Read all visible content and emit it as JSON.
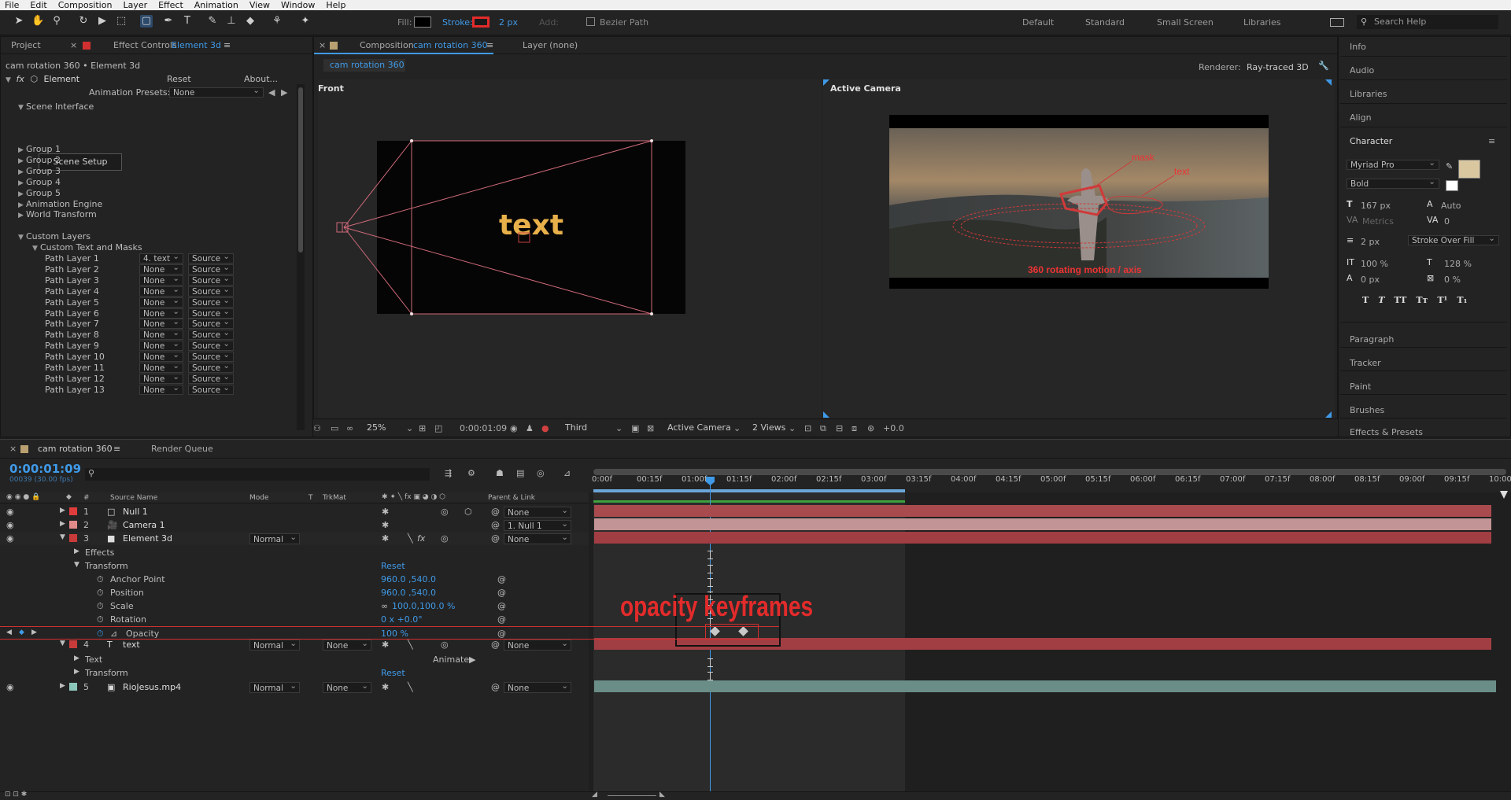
{
  "menu": [
    "File",
    "Edit",
    "Composition",
    "Layer",
    "Effect",
    "Animation",
    "View",
    "Window",
    "Help"
  ],
  "toolbar": {
    "fill_label": "Fill:",
    "stroke_label": "Stroke:",
    "stroke_px": "2 px",
    "add_label": "Add:",
    "bezier_label": "Bezier Path",
    "workspaces": [
      "Default",
      "Standard",
      "Small Screen",
      "Libraries"
    ],
    "search_placeholder": "Search Help",
    "fill_color": "#000000",
    "stroke_color": "#e22b2b"
  },
  "effect_panel": {
    "tab_project": "Project",
    "tab_effect": "Effect Controls",
    "tab_effect_target": "Element 3d",
    "subtitle": "cam rotation 360 • Element 3d",
    "fx_name": "Element",
    "reset": "Reset",
    "about": "About...",
    "presets_label": "Animation Presets:",
    "presets_value": "None",
    "scene_interface": "Scene Interface",
    "scene_setup": "Scene Setup",
    "groups": [
      "Group 1",
      "Group 2",
      "Group 3",
      "Group 4",
      "Group 5",
      "Animation Engine",
      "World Transform"
    ],
    "custom_layers": "Custom Layers",
    "custom_text": "Custom Text and Masks",
    "path_layers": [
      {
        "name": "Path Layer 1",
        "layer": "4. text",
        "src": "Source"
      },
      {
        "name": "Path Layer 2",
        "layer": "None",
        "src": "Source"
      },
      {
        "name": "Path Layer 3",
        "layer": "None",
        "src": "Source"
      },
      {
        "name": "Path Layer 4",
        "layer": "None",
        "src": "Source"
      },
      {
        "name": "Path Layer 5",
        "layer": "None",
        "src": "Source"
      },
      {
        "name": "Path Layer 6",
        "layer": "None",
        "src": "Source"
      },
      {
        "name": "Path Layer 7",
        "layer": "None",
        "src": "Source"
      },
      {
        "name": "Path Layer 8",
        "layer": "None",
        "src": "Source"
      },
      {
        "name": "Path Layer 9",
        "layer": "None",
        "src": "Source"
      },
      {
        "name": "Path Layer 10",
        "layer": "None",
        "src": "Source"
      },
      {
        "name": "Path Layer 11",
        "layer": "None",
        "src": "Source"
      },
      {
        "name": "Path Layer 12",
        "layer": "None",
        "src": "Source"
      },
      {
        "name": "Path Layer 13",
        "layer": "None",
        "src": "Source"
      }
    ]
  },
  "comp": {
    "tab_label": "Composition",
    "tab_target": "cam rotation 360",
    "layer_tab": "Layer (none)",
    "breadcrumb": "cam rotation 360",
    "renderer_label": "Renderer:",
    "renderer_value": "Ray-traced 3D",
    "view_front": "Front",
    "view_active": "Active Camera",
    "front_text": "text",
    "annotations": {
      "mask": "mask",
      "text": "text",
      "axis": "360 rotating motion / axis"
    },
    "footer": {
      "zoom": "25%",
      "time": "0:00:01:09",
      "resolution": "Third",
      "camera": "Active Camera",
      "views": "2 Views",
      "exposure": "+0.0"
    }
  },
  "right_panel": {
    "items_top": [
      "Info",
      "Audio",
      "Libraries",
      "Align"
    ],
    "character": "Character",
    "font": "Myriad Pro",
    "style": "Bold",
    "size": "167 px",
    "leading": "Auto",
    "kerning": "Metrics",
    "tracking": "0",
    "stroke_w": "2 px",
    "stroke_mode": "Stroke Over Fill",
    "vscale": "100 %",
    "hscale": "128 %",
    "baseline": "0 px",
    "tsume": "0 %",
    "type_buttons": [
      "T",
      "T",
      "TT",
      "Tт",
      "T¹",
      "T₁"
    ],
    "items_bottom": [
      "Paragraph",
      "Tracker",
      "Paint",
      "Brushes",
      "Effects & Presets"
    ],
    "fill_swatch": "#d9c7a0"
  },
  "timeline": {
    "tab": "cam rotation 360",
    "render_queue": "Render Queue",
    "timecode": "0:00:01:09",
    "frames": "00039 (30.00 fps)",
    "col_headers": {
      "num": "#",
      "source": "Source Name",
      "mode": "Mode",
      "t": "T",
      "trkmat": "TrkMat",
      "parent": "Parent & Link"
    },
    "ruler": [
      "0:00f",
      "00:15f",
      "01:00f",
      "01:15f",
      "02:00f",
      "02:15f",
      "03:00f",
      "03:15f",
      "04:00f",
      "04:15f",
      "05:00f",
      "05:15f",
      "06:00f",
      "06:15f",
      "07:00f",
      "07:15f",
      "08:00f",
      "08:15f",
      "09:00f",
      "09:15f",
      "10:00"
    ],
    "layers": [
      {
        "num": "1",
        "name": "Null 1",
        "mode": "",
        "trk": "",
        "parent": "None",
        "color": "#e03c3c"
      },
      {
        "num": "2",
        "name": "Camera 1",
        "mode": "",
        "trk": "",
        "parent": "1. Null 1",
        "color": "#e08a8a"
      },
      {
        "num": "3",
        "name": "Element 3d",
        "mode": "Normal",
        "trk": "",
        "parent": "None",
        "color": "#c93a3a"
      },
      {
        "num": "4",
        "name": "text",
        "mode": "Normal",
        "trk": "None",
        "parent": "None",
        "color": "#c93a3a"
      },
      {
        "num": "5",
        "name": "RioJesus.mp4",
        "mode": "Normal",
        "trk": "None",
        "parent": "None",
        "color": "#8cc7bb"
      }
    ],
    "sub": {
      "effects": "Effects",
      "transform": "Transform",
      "reset": "Reset",
      "anchor": "Anchor Point",
      "anchor_v": "960.0 ,540.0",
      "position": "Position",
      "position_v": "960.0 ,540.0",
      "scale": "Scale",
      "scale_v": "100.0,100.0 %",
      "rotation": "Rotation",
      "rotation_v": "0 x +0.0°",
      "opacity": "Opacity",
      "opacity_v": "100 %",
      "text": "Text",
      "animate": "Animate:"
    },
    "annotation": "opacity keyframes"
  }
}
